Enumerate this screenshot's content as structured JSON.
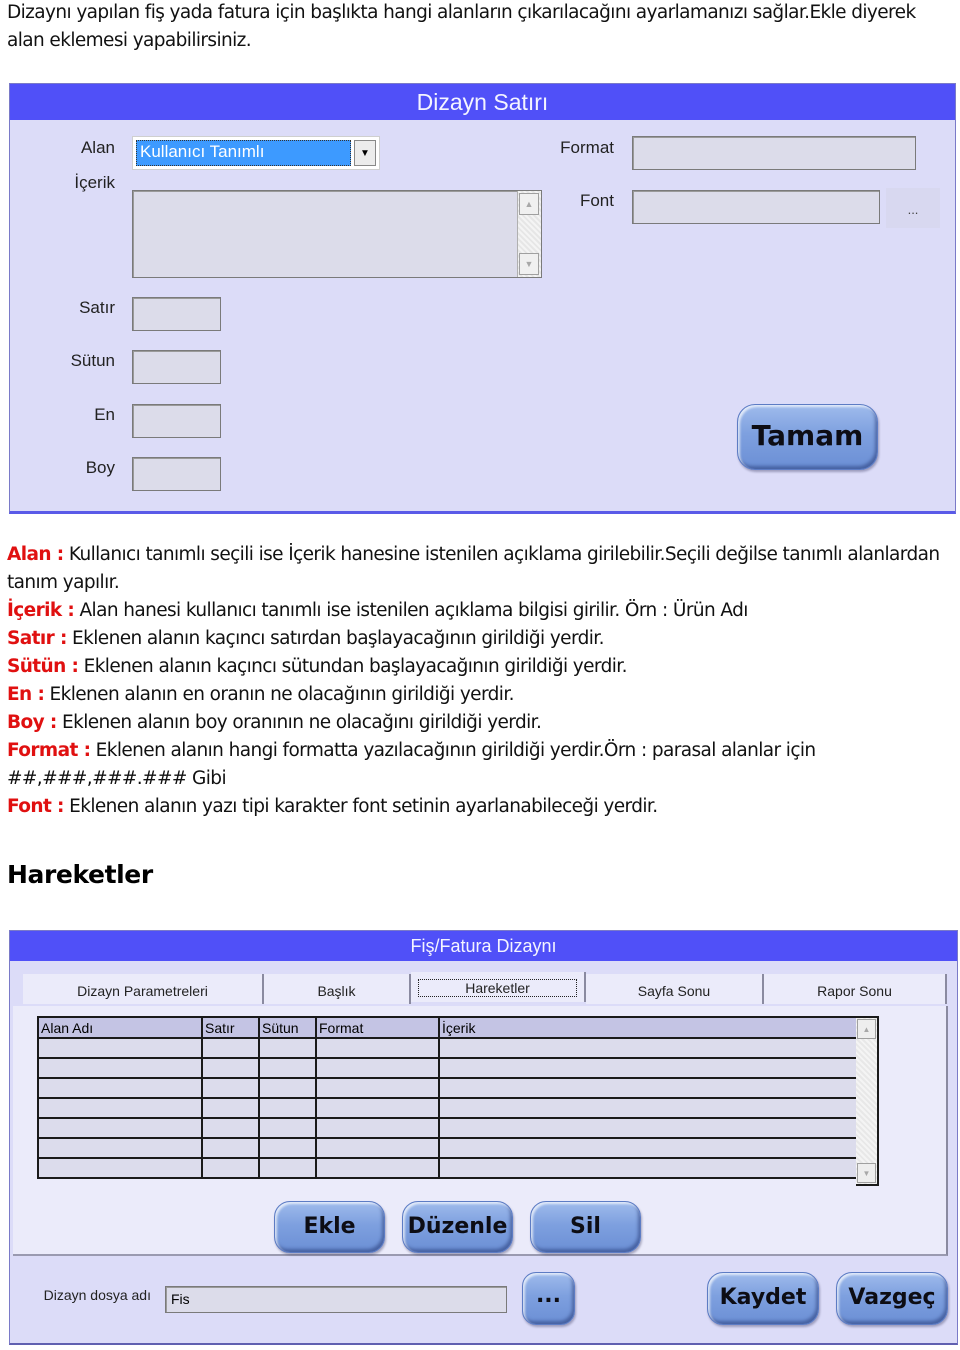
{
  "intro_text": "Dizaynı yapılan fiş yada fatura için başlıkta hangi alanların çıkarılacağını ayarlamanızı sağlar.Ekle diyerek alan eklemesi yapabilirsiniz.",
  "dialog_row": {
    "title": "Dizayn Satırı",
    "alan_label": "Alan",
    "alan_selected": "Kullanıcı Tanımlı",
    "icerik_label": "İçerik",
    "icerik_value": "",
    "format_label": "Format",
    "format_value": "",
    "font_label": "Font",
    "font_value": "",
    "font_browse_label": "...",
    "satir_label": "Satır",
    "sutun_label": "Sütun",
    "en_label": "En",
    "boy_label": "Boy",
    "ok_label": "Tamam"
  },
  "descriptions": [
    {
      "key": "Alan :",
      "text": " Kullanıcı tanımlı seçili ise İçerik hanesine istenilen açıklama girilebilir.Seçili değilse tanımlı alanlardan tanım yapılır."
    },
    {
      "key": "İçerik :",
      "text": "  Alan hanesi kullanıcı tanımlı ise istenilen açıklama bilgisi girilir. Örn : Ürün Adı"
    },
    {
      "key": "Satır :",
      "text": " Eklenen alanın kaçıncı satırdan başlayacağının girildiği yerdir."
    },
    {
      "key": "Sütün :",
      "text": " Eklenen alanın kaçıncı sütundan başlayacağının girildiği yerdir."
    },
    {
      "key": "En :",
      "text": " Eklenen alanın en oranın ne olacağının girildiği yerdir."
    },
    {
      "key": "Boy :",
      "text": " Eklenen alanın boy oranının ne olacağını girildiği yerdir."
    },
    {
      "key": "Format :",
      "text": " Eklenen alanın hangi formatta yazılacağının girildiği yerdir.Örn : parasal alanlar için ##,###,###.### Gibi"
    },
    {
      "key": "Font :",
      "text": " Eklenen alanın yazı tipi karakter font setinin ayarlanabileceği yerdir."
    }
  ],
  "section_heading": "Hareketler",
  "dialog_design": {
    "title": "Fiş/Fatura Dizaynı",
    "tabs": [
      {
        "label": "Dizayn Parametreleri",
        "active": false
      },
      {
        "label": "Başlık",
        "active": false
      },
      {
        "label": "Hareketler",
        "active": true
      },
      {
        "label": "Sayfa Sonu",
        "active": false
      },
      {
        "label": "Rapor Sonu",
        "active": false
      }
    ],
    "table": {
      "columns": [
        "Alan Adı",
        "Satır",
        "Sütun",
        "Format",
        "İçerik"
      ],
      "rows": [
        [
          "",
          "",
          "",
          "",
          ""
        ],
        [
          "",
          "",
          "",
          "",
          ""
        ],
        [
          "",
          "",
          "",
          "",
          ""
        ],
        [
          "",
          "",
          "",
          "",
          ""
        ],
        [
          "",
          "",
          "",
          "",
          ""
        ],
        [
          "",
          "",
          "",
          "",
          ""
        ],
        [
          "",
          "",
          "",
          "",
          ""
        ]
      ]
    },
    "add_label": "Ekle",
    "edit_label": "Düzenle",
    "delete_label": "Sil",
    "file_label": "Dizayn dosya adı",
    "file_value": "Fis",
    "browse_label": "...",
    "save_label": "Kaydet",
    "cancel_label": "Vazgeç"
  },
  "colors": {
    "titlebar": "#5050f8",
    "dialog_bg": "#dcdcf8",
    "key_red": "#e01010",
    "button_blue": "#7ea0df",
    "selection_blue": "#3d9aff"
  }
}
